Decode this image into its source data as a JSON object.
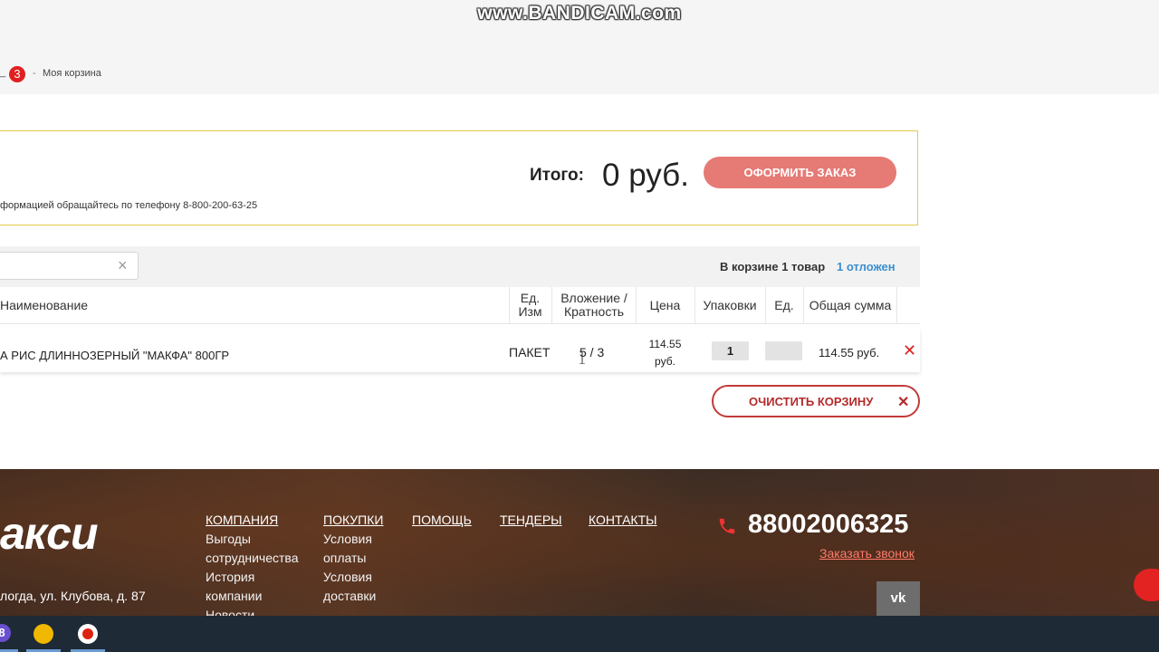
{
  "watermark": "www.BANDICAM.com",
  "breadcrumb": {
    "lead": "...",
    "badge": "3",
    "sep": "-",
    "current": "Моя корзина"
  },
  "summary": {
    "phone_note": "формацией обращайтесь по телефону 8-800-200-63-25",
    "total_label": "Итого:",
    "total_value": "0 руб.",
    "order_button": "ОФОРМИТЬ ЗАКАЗ"
  },
  "toolbar": {
    "search_value": "",
    "clear_icon": "×",
    "count_label": "В корзине 1 товар",
    "deferred_link": "1 отложен"
  },
  "table": {
    "columns": [
      "Наименование",
      "Ед. Изм",
      "Вложение /Кратность",
      "Цена",
      "Упаковки",
      "Ед.",
      "Общая сумма"
    ],
    "rows": [
      {
        "name": "А РИС ДЛИННОЗЕРНЫЙ \"МАКФА\" 800ГР",
        "unit": "ПАКЕТ",
        "pack": "5 / 3",
        "price_num": "114.55",
        "price_cur": "руб.",
        "packages": "1",
        "units": "",
        "total": "114.55 руб.",
        "delete_icon": "✕"
      }
    ]
  },
  "clear_cart": {
    "label": "ОЧИСТИТЬ КОРЗИНУ",
    "icon": "✕"
  },
  "footer": {
    "logo": "акси",
    "address": "логда, ул. Клубова, д. 87",
    "nav": [
      {
        "title": "КОМПАНИЯ",
        "items": [
          "Выгоды",
          "сотрудничества",
          "История",
          "компании",
          "Новости"
        ]
      },
      {
        "title": "ПОКУПКИ",
        "items": [
          "Условия",
          "оплаты",
          "Условия",
          "доставки"
        ]
      },
      {
        "title": "ПОМОЩЬ",
        "items": []
      },
      {
        "title": "ТЕНДЕРЫ",
        "items": []
      },
      {
        "title": "КОНТАКТЫ",
        "items": []
      }
    ],
    "phone": "88002006325",
    "callback": "Заказать звонок",
    "vk": "vk"
  },
  "colors": {
    "accent_red": "#e67a75",
    "link_blue": "#3a8fd0",
    "border_yellow": "#e0c94a"
  }
}
